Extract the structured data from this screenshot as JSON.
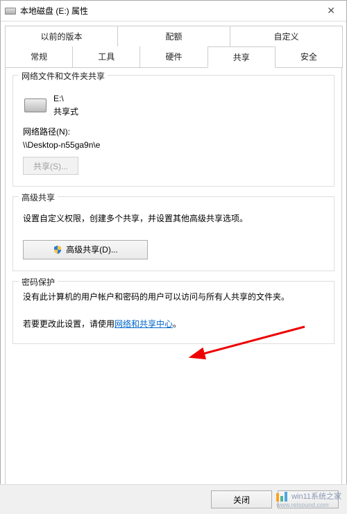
{
  "titlebar": {
    "title": "本地磁盘 (E:) 属性"
  },
  "tabs": {
    "row1": [
      {
        "label": "以前的版本"
      },
      {
        "label": "配额"
      },
      {
        "label": "自定义"
      }
    ],
    "row2": [
      {
        "label": "常规"
      },
      {
        "label": "工具"
      },
      {
        "label": "硬件"
      },
      {
        "label": "共享"
      },
      {
        "label": "安全"
      }
    ]
  },
  "sharing": {
    "legend": "网络文件和文件夹共享",
    "drive_path": "E:\\",
    "status": "共享式",
    "netpath_label": "网络路径(N):",
    "netpath_value": "\\\\Desktop-n55ga9n\\e",
    "share_button": "共享(S)..."
  },
  "advanced": {
    "legend": "高级共享",
    "desc": "设置自定义权限，创建多个共享，并设置其他高级共享选项。",
    "button": "高级共享(D)..."
  },
  "password": {
    "legend": "密码保护",
    "line1": "没有此计算机的用户帐户和密码的用户可以访问与所有人共享的文件夹。",
    "line2_prefix": "若要更改此设置，请使用",
    "link": "网络和共享中心",
    "line2_suffix": "。"
  },
  "buttons": {
    "close": "关闭",
    "cancel": ""
  },
  "watermark": {
    "text": "win11系统之家",
    "url": "www.relsound.com"
  }
}
